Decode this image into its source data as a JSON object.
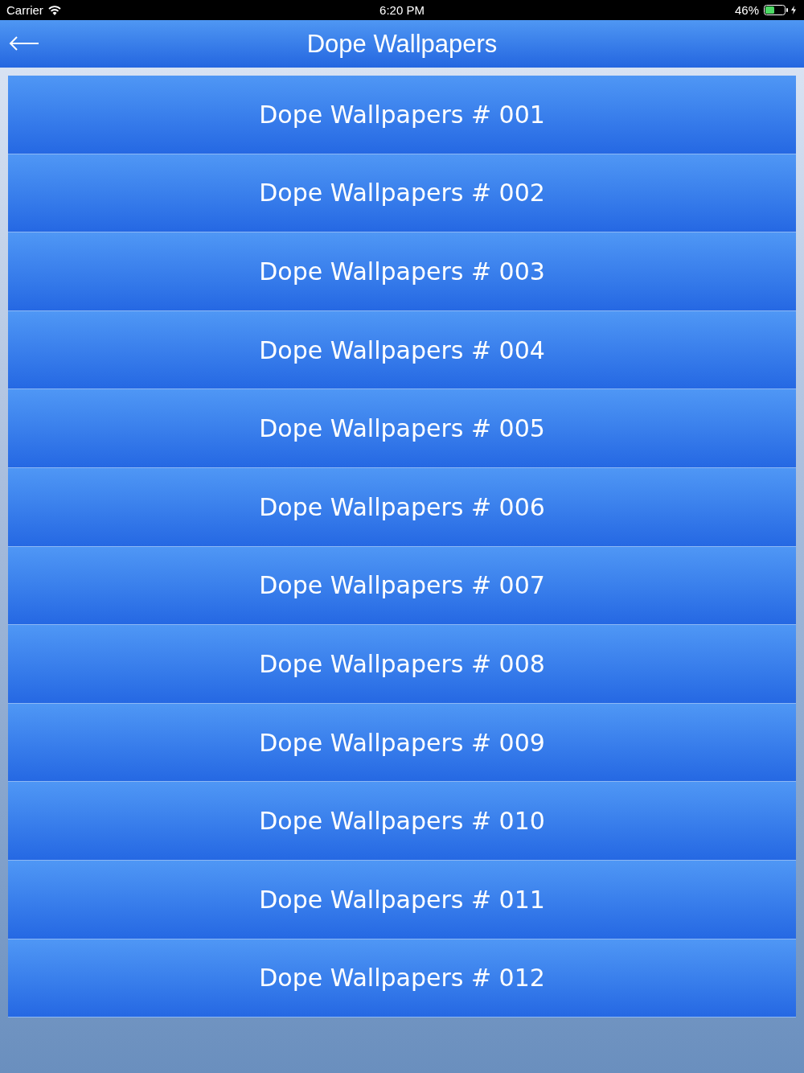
{
  "status_bar": {
    "carrier": "Carrier",
    "time": "6:20 PM",
    "battery": "46%"
  },
  "nav_bar": {
    "title": "Dope Wallpapers"
  },
  "list": {
    "items": [
      {
        "label": "Dope Wallpapers # 001"
      },
      {
        "label": "Dope Wallpapers # 002"
      },
      {
        "label": "Dope Wallpapers # 003"
      },
      {
        "label": "Dope Wallpapers # 004"
      },
      {
        "label": "Dope Wallpapers # 005"
      },
      {
        "label": "Dope Wallpapers # 006"
      },
      {
        "label": "Dope Wallpapers # 007"
      },
      {
        "label": "Dope Wallpapers # 008"
      },
      {
        "label": "Dope Wallpapers # 009"
      },
      {
        "label": "Dope Wallpapers # 010"
      },
      {
        "label": "Dope Wallpapers # 011"
      },
      {
        "label": "Dope Wallpapers # 012"
      }
    ]
  }
}
